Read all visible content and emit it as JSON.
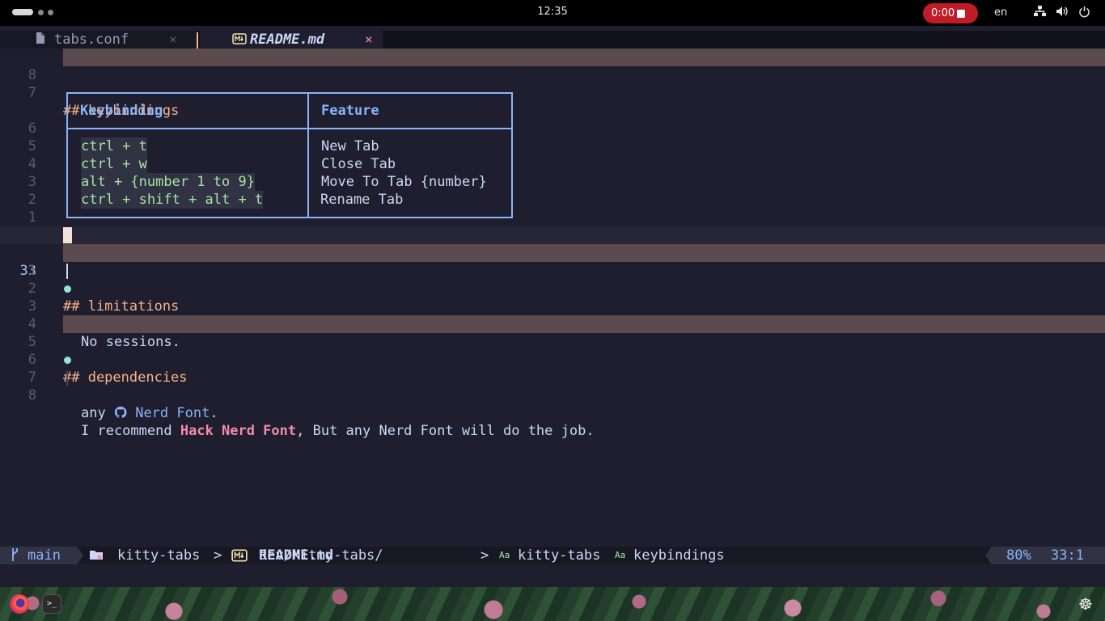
{
  "system_bar": {
    "clock": "12:35",
    "recording": "0:00",
    "language": "en"
  },
  "tabs": [
    {
      "icon": "file-icon",
      "label": "tabs.conf",
      "close": "×"
    },
    {
      "icon": "markdown-icon",
      "label": "README.md",
      "close": "×"
    }
  ],
  "editor": {
    "heading_keybindings": "## keybindings",
    "table": {
      "headers": [
        "Keybinding",
        "Feature"
      ],
      "rows": [
        [
          "ctrl + t",
          "New Tab"
        ],
        [
          "ctrl + w",
          "Close Tab"
        ],
        [
          "alt + {number 1 to 9}",
          "Move To Tab {number}"
        ],
        [
          "ctrl + shift + alt + t",
          "Rename Tab"
        ]
      ]
    },
    "heading_limitations": "## limitations",
    "limitation_item": "No sessions.",
    "heading_dependencies": "## dependencies",
    "dep_prefix": "any ",
    "dep_github_icon": "",
    "dep_link": "Nerd Font",
    "dep_suffix": ".",
    "recommend_prefix": "I recommend ",
    "recommend_strong": "Hack Nerd Font",
    "recommend_suffix": ", But any Nerd Font will do the job.",
    "line_numbers": [
      "8",
      "7",
      "6",
      "5",
      "4",
      "3",
      "2",
      "1",
      "33",
      "1",
      "2",
      "3",
      "4",
      "5",
      "6",
      "7",
      "8"
    ]
  },
  "statusline": {
    "branch_icon": "",
    "branch": "main",
    "folder_icon": "folder-icon",
    "project": "kitty-tabs",
    "path_prefix": "dev/kitty-tabs/",
    "path_file": "README.md",
    "sep": ">",
    "crumb_icon": "Aa",
    "crumb1": "kitty-tabs",
    "crumb2": "keybindings",
    "percent": "80%",
    "position": "33:1"
  },
  "colors": {
    "background": "#1e1e2e",
    "heading": "#fab387",
    "accent": "#89b4fa",
    "strong": "#f38ba8",
    "bullet": "#94e2d5",
    "record": "#c01c28"
  }
}
